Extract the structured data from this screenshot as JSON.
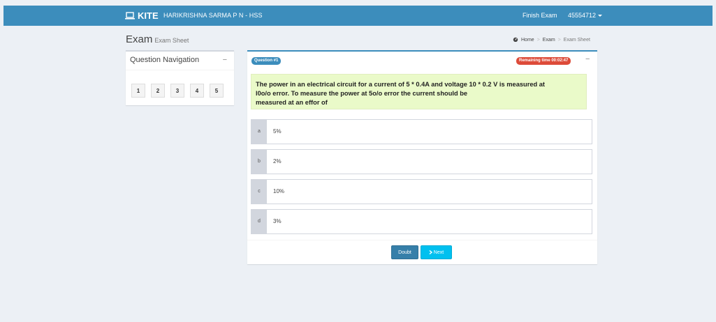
{
  "header": {
    "brand": "KITE",
    "user": "HARIKRISHNA SARMA P N - HSS",
    "finish_label": "Finish Exam",
    "account_id": "45554712"
  },
  "page": {
    "title": "Exam",
    "subtitle": "Exam Sheet"
  },
  "breadcrumb": [
    "Home",
    "Exam",
    "Exam Sheet"
  ],
  "navigation": {
    "title": "Question Navigation",
    "collapse_symbol": "−",
    "questions": [
      "1",
      "2",
      "3",
      "4",
      "5"
    ]
  },
  "question": {
    "badge": "Question #1",
    "timer": "Remaining time 00:02:47",
    "collapse_symbol": "−",
    "line1": "The power in an electrical circuit for a current of 5 * 0.4A and voltage 10 * 0.2 V is measured at",
    "line2": "l0o/o error. To measure the power at 5o/o error the current should be",
    "line3": "measured at an effor of",
    "options": [
      {
        "letter": "a",
        "text": "5%"
      },
      {
        "letter": "b",
        "text": "2%"
      },
      {
        "letter": "c",
        "text": "10%"
      },
      {
        "letter": "d",
        "text": "3%"
      }
    ]
  },
  "actions": {
    "doubt": "Doubt",
    "next": "Next"
  },
  "colors": {
    "header": "#3c8dbc",
    "question_bg": "#eafac9",
    "timer": "#dd4b39",
    "next": "#00c0ef"
  }
}
